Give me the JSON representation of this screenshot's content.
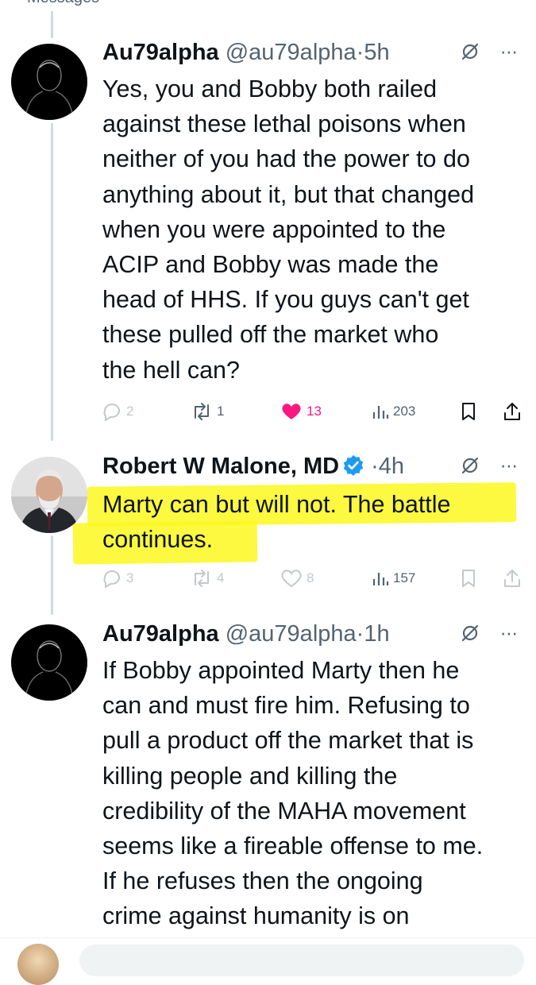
{
  "top_bar": {
    "back_label": "Messages"
  },
  "colors": {
    "text": "#0f1419",
    "secondary": "#536471",
    "like_active": "#f91880",
    "verified": "#1d9bf0",
    "highlight": "#fbf81f"
  },
  "tweets": [
    {
      "name": "Au79alpha",
      "handle": "@au79alpha",
      "dot": "·",
      "time": "5h",
      "avatar_icon": "silhouette-avatar",
      "verified": false,
      "lines": [
        "Yes, you and Bobby both railed",
        "against these lethal poisons when",
        "neither of you had the power to do",
        "anything about it, but that changed",
        "when you were appointed to the",
        "ACIP and Bobby was made the",
        "head of HHS. If you guys can't get",
        "these pulled off the market who",
        "the hell can?"
      ],
      "stats": {
        "replies": "2",
        "reposts": "1",
        "likes": "13",
        "views": "203"
      },
      "liked": true
    },
    {
      "name": "Robert W Malone, MD",
      "handle": "",
      "dot": "·",
      "time": "4h",
      "avatar_icon": "portrait-avatar",
      "verified": true,
      "lines": [
        "Marty can but will not.  The battle",
        "continues."
      ],
      "highlighted": true,
      "stats": {
        "replies": "3",
        "reposts": "4",
        "likes": "8",
        "views": "157"
      },
      "liked": false
    },
    {
      "name": "Au79alpha",
      "handle": "@au79alpha",
      "dot": "·",
      "time": "1h",
      "avatar_icon": "silhouette-avatar",
      "verified": false,
      "lines": [
        "If Bobby appointed Marty then he",
        "can and must fire him. Refusing to",
        "pull a product off the market that is",
        "killing people and killing the",
        "credibility of the MAHA movement",
        "seems like a fireable offense to me.",
        "If he refuses then the ongoing",
        "crime against humanity is on"
      ]
    }
  ],
  "icons": {
    "more": "⋯",
    "grok": "grok-icon",
    "reply": "reply-icon",
    "repost": "repost-icon",
    "like": "heart-icon",
    "views": "views-icon",
    "bookmark": "bookmark-icon",
    "share": "share-icon"
  }
}
